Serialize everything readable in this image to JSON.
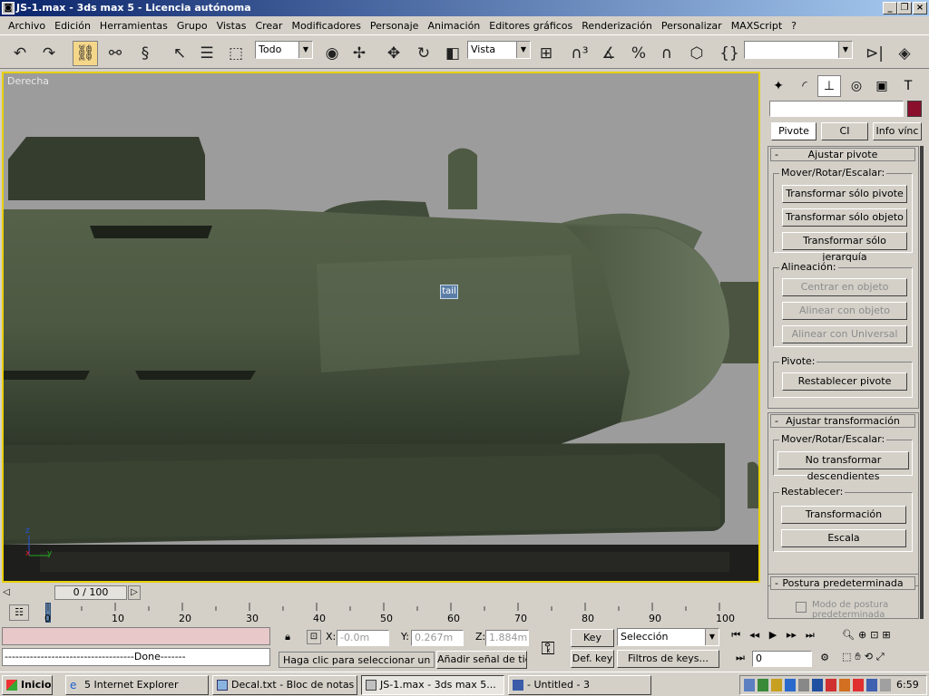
{
  "window": {
    "title": "JS-1.max - 3ds max 5 - Licencia autónoma",
    "icon": "max-icon"
  },
  "menu": [
    "Archivo",
    "Edición",
    "Herramientas",
    "Grupo",
    "Vistas",
    "Crear",
    "Modificadores",
    "Personaje",
    "Animación",
    "Editores gráficos",
    "Renderización",
    "Personalizar",
    "MAXScript",
    "?"
  ],
  "toolbar": {
    "selection_filter": "Todo",
    "ref_coord": "Vista",
    "named_sel": ""
  },
  "viewport": {
    "label": "Derecha",
    "object_tag": "tail",
    "axis_z": "z",
    "axis_x": "x",
    "axis_y": "y"
  },
  "cmdpanel": {
    "subtabs": [
      "Pivote",
      "CI",
      "Info vínc"
    ],
    "name_field": "",
    "object_color": "#8a0f2c",
    "rollout1": {
      "title": "Ajustar pivote",
      "group1": {
        "label": "Mover/Rotar/Escalar:",
        "buttons": [
          "Transformar sólo pivote",
          "Transformar sólo objeto",
          "Transformar sólo jerarquía"
        ]
      },
      "group2": {
        "label": "Alineación:",
        "buttons": [
          "Centrar en objeto",
          "Alinear con objeto",
          "Alinear con Universal"
        ]
      },
      "group3": {
        "label": "Pivote:",
        "button": "Restablecer pivote"
      }
    },
    "rollout2": {
      "title": "Ajustar transformación",
      "group1": {
        "label": "Mover/Rotar/Escalar:",
        "button": "No transformar descendientes"
      },
      "group2": {
        "label": "Restablecer:",
        "buttons": [
          "Transformación",
          "Escala"
        ]
      }
    },
    "rollout3": {
      "title": "Postura predeterminada",
      "checkbox": "Modo de postura predeterminada"
    }
  },
  "timeline": {
    "slider": "0 / 100",
    "ticks": [
      "0",
      "10",
      "20",
      "30",
      "40",
      "50",
      "60",
      "70",
      "80",
      "90",
      "100"
    ]
  },
  "status": {
    "listener_output": "------------------------------------Done-------",
    "x_label": "X:",
    "x": "-0.0m",
    "y_label": "Y:",
    "y": "0.267m",
    "z_label": "Z:",
    "z": "1.884m",
    "prompt": "Haga clic para seleccionar un obje",
    "add_key": "Añadir señal de tiem",
    "key_auto": "Key auto",
    "key_mode": "Selección",
    "def_key": "Def. key",
    "key_filters": "Filtros de keys...",
    "frame": "0"
  },
  "taskbar": {
    "start": "Inicio",
    "tasks": [
      "5 Internet Explorer",
      "Decal.txt - Bloc de notas",
      "JS-1.max - 3ds max 5...",
      "- Untitled - 3"
    ],
    "clock": "6:59"
  }
}
